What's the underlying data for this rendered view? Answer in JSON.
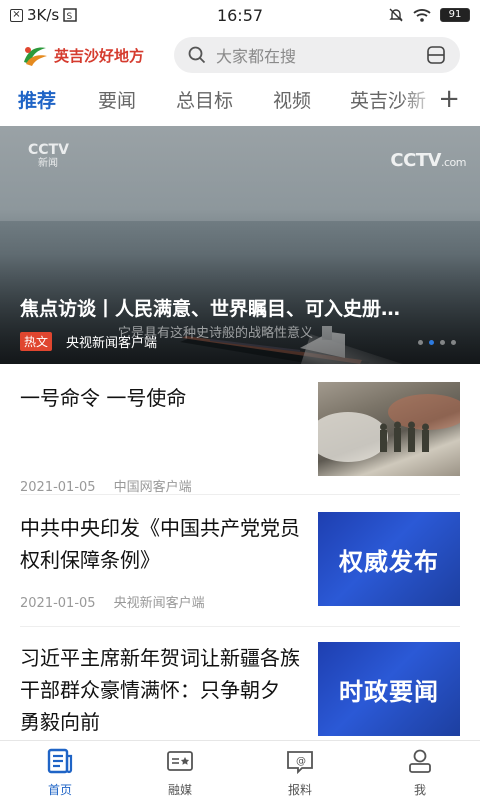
{
  "status_bar": {
    "speed": "3K/s",
    "time": "16:57",
    "battery": "91"
  },
  "header": {
    "app_name": "英吉沙好地方",
    "search_placeholder": "大家都在搜"
  },
  "tabs": [
    "推荐",
    "要闻",
    "总目标",
    "视频",
    "英吉沙新"
  ],
  "banner": {
    "watermark_left": "CCTV",
    "watermark_left_sub": "新闻",
    "watermark_right": "CCTV",
    "watermark_right_sub": ".com",
    "title": "焦点访谈丨人民满意、世界瞩目、可入史册…",
    "subtitle": "它是具有这种史诗般的战略性意义",
    "tag": "热文",
    "source": "央视新闻客户端"
  },
  "news": [
    {
      "title": "一号命令 一号使命",
      "date": "2021-01-05",
      "source": "中国网客户端",
      "thumb_text": ""
    },
    {
      "title": "中共中央印发《中国共产党党员权利保障条例》",
      "date": "2021-01-05",
      "source": "央视新闻客户端",
      "thumb_text": "权威发布"
    },
    {
      "title": "习近平主席新年贺词让新疆各族干部群众豪情满怀：只争朝夕 勇毅向前",
      "date": "",
      "source": "",
      "thumb_text": "时政要闻"
    }
  ],
  "bottom_nav": [
    "首页",
    "融媒",
    "报料",
    "我"
  ],
  "colors": {
    "accent": "#1f64c6",
    "brand_red": "#d53b2e",
    "hot_tag": "#e0462f"
  }
}
